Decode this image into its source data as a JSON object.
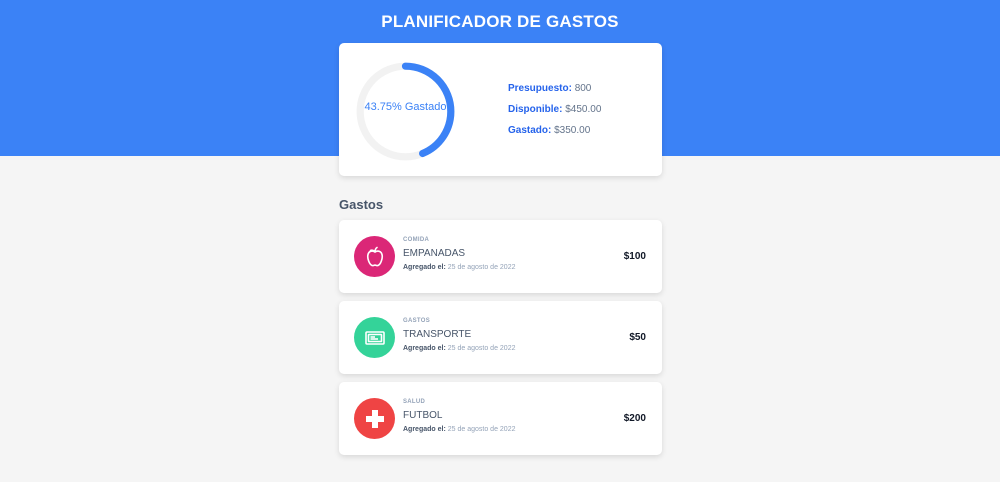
{
  "app": {
    "title": "PLANIFICADOR DE GASTOS"
  },
  "summary": {
    "progress_percent": 43.75,
    "progress_label": "43.75% Gastado",
    "budget_key": "Presupuesto:",
    "budget_value": "800",
    "available_key": "Disponible:",
    "available_value": "$450.00",
    "spent_key": "Gastado:",
    "spent_value": "$350.00"
  },
  "expenses_heading": "Gastos",
  "expenses": [
    {
      "category": "COMIDA",
      "name": "EMPANADAS",
      "date_key": "Agregado el:",
      "date_value": "25 de agosto de 2022",
      "amount": "$100",
      "icon": "apple-icon",
      "color": "#db2777"
    },
    {
      "category": "GASTOS",
      "name": "TRANSPORTE",
      "date_key": "Agregado el:",
      "date_value": "25 de agosto de 2022",
      "amount": "$50",
      "icon": "card-icon",
      "color": "#34d399"
    },
    {
      "category": "SALUD",
      "name": "FUTBOL",
      "date_key": "Agregado el:",
      "date_value": "25 de agosto de 2022",
      "amount": "$200",
      "icon": "medical-cross-icon",
      "color": "#ef4444"
    }
  ],
  "colors": {
    "header": "#3b82f6",
    "accent": "#2563eb"
  }
}
